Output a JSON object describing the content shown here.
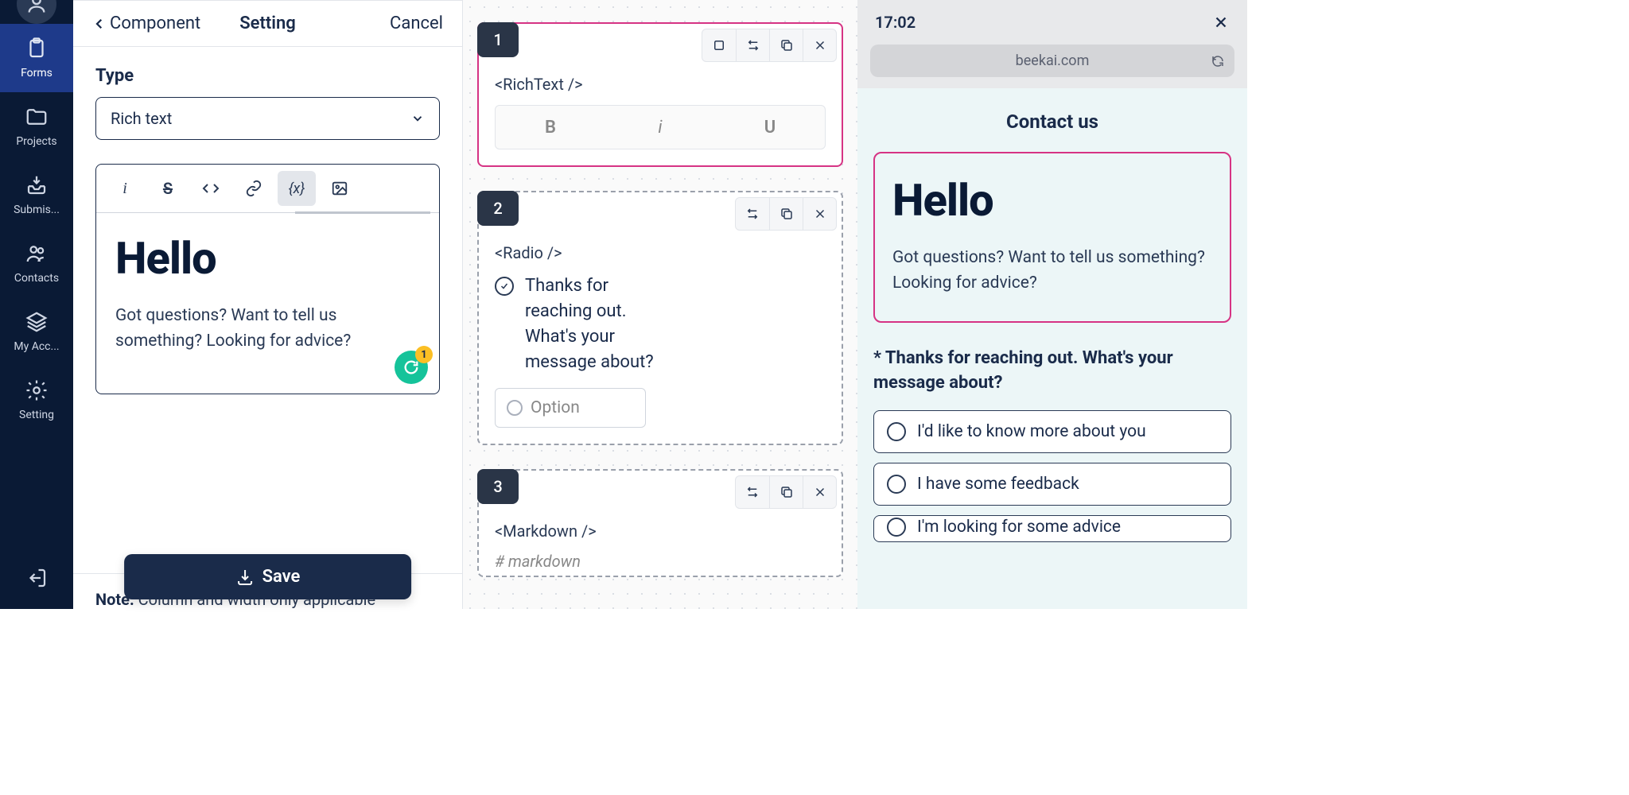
{
  "sidebar": {
    "items": [
      {
        "label": "Forms"
      },
      {
        "label": "Projects"
      },
      {
        "label": "Submis..."
      },
      {
        "label": "Contacts"
      },
      {
        "label": "My Acc..."
      },
      {
        "label": "Setting"
      }
    ]
  },
  "editor": {
    "back_label": "Component",
    "tab": "Setting",
    "cancel": "Cancel",
    "type_label": "Type",
    "type_value": "Rich text",
    "content_heading": "Hello",
    "content_body": "Got questions? Want to tell us something? Looking for advice?",
    "grammarly_count": "1",
    "note_label": "Note:",
    "note_text": " Column and width only applicable",
    "save": "Save"
  },
  "canvas": {
    "blocks": [
      {
        "num": "1",
        "tag": "<RichText />",
        "tools": [
          "B",
          "i",
          "U"
        ]
      },
      {
        "num": "2",
        "tag": "<Radio />",
        "question": "Thanks for reaching out. What's your message about?",
        "option_placeholder": "Option"
      },
      {
        "num": "3",
        "tag": "<Markdown />",
        "hint": "# markdown"
      }
    ]
  },
  "preview": {
    "time": "17:02",
    "url": "beekai.com",
    "title": "Contact us",
    "hello_heading": "Hello",
    "hello_body": "Got questions? Want to tell us something? Looking for advice?",
    "question": "* Thanks for reaching out. What's your message about?",
    "options": [
      "I'd like to know more about you",
      "I have some feedback",
      "I'm looking for some advice"
    ]
  }
}
